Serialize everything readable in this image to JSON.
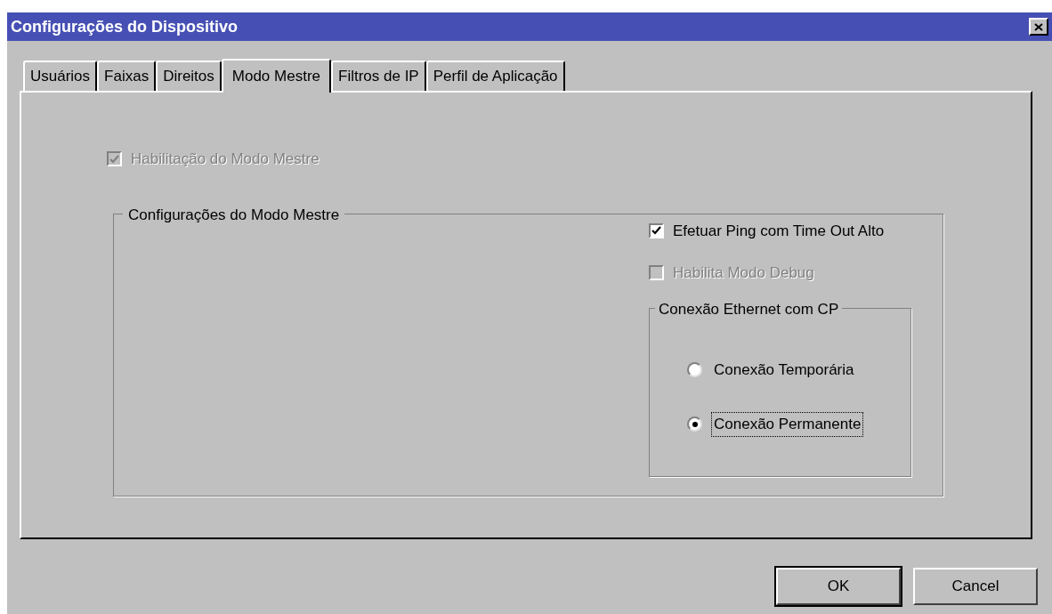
{
  "window": {
    "title": "Configurações do Dispositivo"
  },
  "tabs": [
    {
      "label": "Usuários",
      "selected": false
    },
    {
      "label": "Faixas",
      "selected": false
    },
    {
      "label": "Direitos",
      "selected": false
    },
    {
      "label": "Modo Mestre",
      "selected": true
    },
    {
      "label": "Filtros de IP",
      "selected": false
    },
    {
      "label": "Perfil de Aplicação",
      "selected": false
    }
  ],
  "master_enable": {
    "label": "Habilitação do Modo Mestre",
    "checked": true,
    "disabled": true
  },
  "master_settings": {
    "title": "Configurações do Modo Mestre",
    "options": [
      {
        "label": "Efetuar Ping com Time Out Alto",
        "checked": true,
        "disabled": false
      },
      {
        "label": "Habilita Modo Debug",
        "checked": false,
        "disabled": true
      }
    ],
    "ethernet": {
      "title": "Conexão Ethernet com CP",
      "radios": [
        {
          "label": "Conexão Temporária",
          "selected": false,
          "focused": false
        },
        {
          "label": "Conexão Permanente",
          "selected": true,
          "focused": true
        }
      ]
    }
  },
  "buttons": [
    {
      "label": "OK",
      "default": true
    },
    {
      "label": "Cancel",
      "default": false
    }
  ]
}
